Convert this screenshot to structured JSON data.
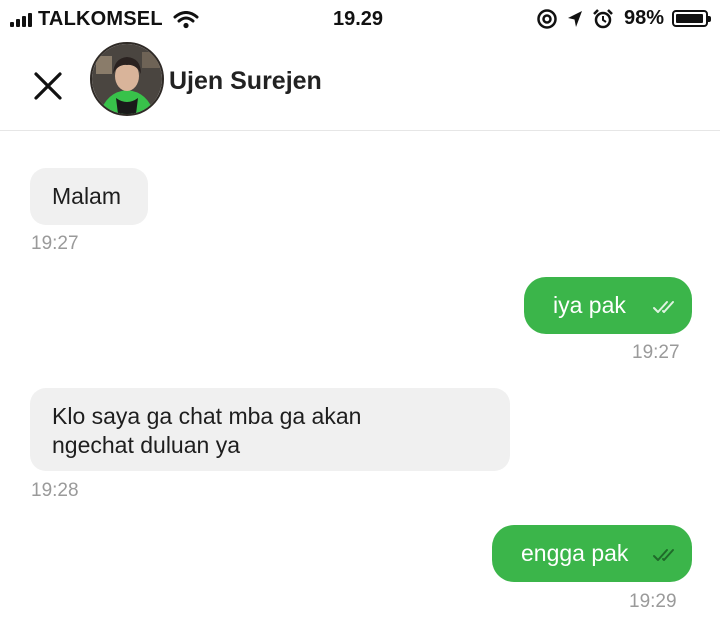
{
  "status_bar": {
    "carrier": "TALKOMSEL",
    "time": "19.29",
    "battery_percent": "98%",
    "battery_level": 0.98,
    "icons": [
      "signal-icon",
      "wifi-icon",
      "at-icon",
      "location-arrow-icon",
      "alarm-icon",
      "battery-icon"
    ]
  },
  "header": {
    "contact_name": "Ujen Surejen",
    "close_icon": "close-icon"
  },
  "messages": [
    {
      "direction": "incoming",
      "text_lines": [
        "Malam"
      ],
      "time": "19:27"
    },
    {
      "direction": "outgoing",
      "text_lines": [
        "iya pak"
      ],
      "time": "19:27",
      "status": "read"
    },
    {
      "direction": "incoming",
      "text_lines": [
        "Klo saya ga chat mba ga akan",
        "ngechat duluan ya"
      ],
      "time": "19:28"
    },
    {
      "direction": "outgoing",
      "text_lines": [
        "engga pak"
      ],
      "time": "19:29",
      "status": "read"
    }
  ],
  "colors": {
    "outgoing_bubble": "#3bb54a",
    "incoming_bubble": "#f0f0f0",
    "timestamp": "#9a9a9a"
  }
}
